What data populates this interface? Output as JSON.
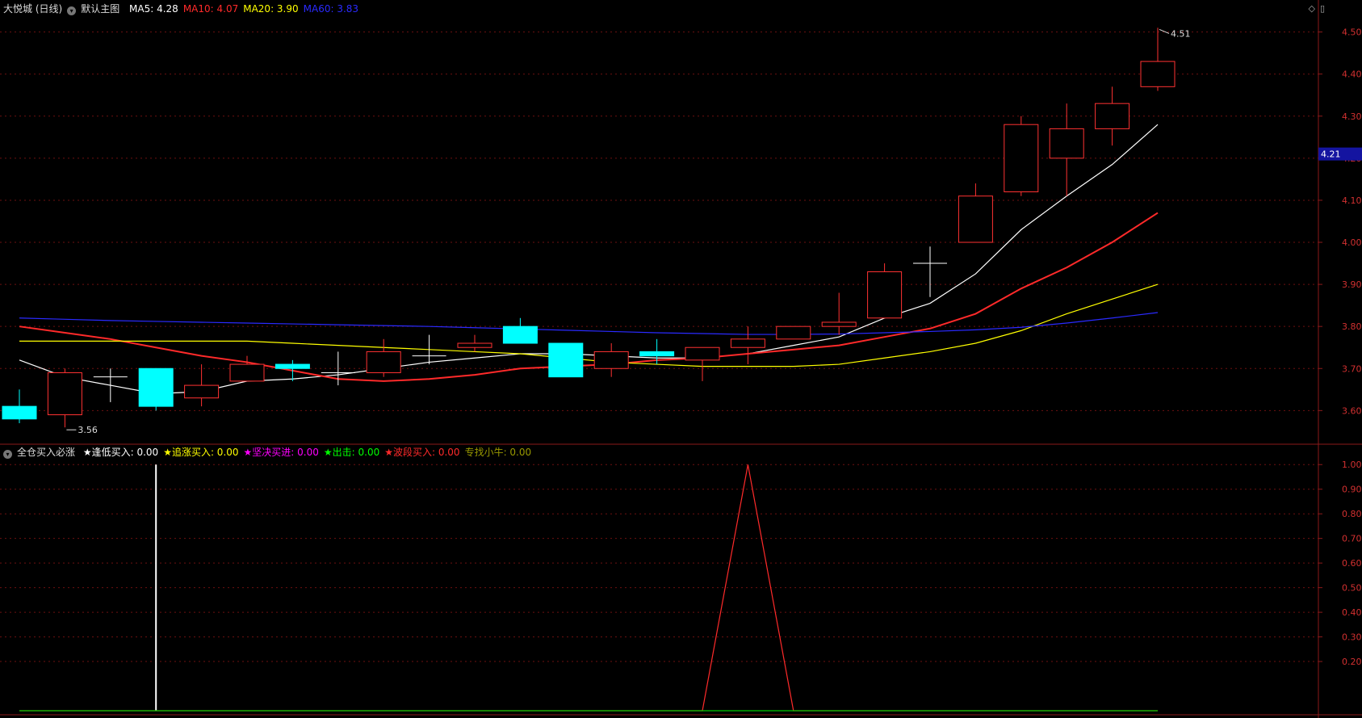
{
  "main": {
    "title": "大悦城 (日线)",
    "template": "默认主图",
    "ma": [
      {
        "label": "MA5:",
        "value": "4.28",
        "color": "#ffffff"
      },
      {
        "label": "MA10:",
        "value": "4.07",
        "color": "#ff2a2a"
      },
      {
        "label": "MA20:",
        "value": "3.90",
        "color": "#ffff00"
      },
      {
        "label": "MA60:",
        "value": "3.83",
        "color": "#2a2aff"
      }
    ],
    "last_price_tag": "4.21",
    "high_marker": "4.51",
    "low_marker": "3.56"
  },
  "sub": {
    "title": "全仓买入必涨",
    "indicators": [
      {
        "label": "★逢低买入:",
        "value": "0.00",
        "color": "#ffffff"
      },
      {
        "label": "★追涨买入:",
        "value": "0.00",
        "color": "#ffff00"
      },
      {
        "label": "★坚决买进:",
        "value": "0.00",
        "color": "#ff00ff"
      },
      {
        "label": "★出击:",
        "value": "0.00",
        "color": "#00ff00"
      },
      {
        "label": "★波段买入:",
        "value": "0.00",
        "color": "#ff2a2a"
      },
      {
        "label": "专找小牛:",
        "value": "0.00",
        "color": "#999900"
      }
    ]
  },
  "chart_data": [
    {
      "type": "candlestick",
      "name": "price",
      "ylim": [
        3.52,
        4.53
      ],
      "y_ticks": [
        "4.50",
        "4.40",
        "4.30",
        "4.20",
        "4.10",
        "4.00",
        "3.90",
        "3.80",
        "3.70",
        "3.60"
      ],
      "grid": true,
      "candles": [
        {
          "o": 3.61,
          "h": 3.65,
          "l": 3.57,
          "c": 3.58
        },
        {
          "o": 3.59,
          "h": 3.7,
          "l": 3.56,
          "c": 3.69
        },
        {
          "o": 3.68,
          "h": 3.7,
          "l": 3.62,
          "c": 3.68
        },
        {
          "o": 3.7,
          "h": 3.7,
          "l": 3.6,
          "c": 3.61
        },
        {
          "o": 3.63,
          "h": 3.71,
          "l": 3.61,
          "c": 3.66
        },
        {
          "o": 3.67,
          "h": 3.73,
          "l": 3.67,
          "c": 3.71
        },
        {
          "o": 3.71,
          "h": 3.72,
          "l": 3.67,
          "c": 3.7
        },
        {
          "o": 3.69,
          "h": 3.74,
          "l": 3.66,
          "c": 3.69
        },
        {
          "o": 3.69,
          "h": 3.77,
          "l": 3.68,
          "c": 3.74
        },
        {
          "o": 3.73,
          "h": 3.78,
          "l": 3.71,
          "c": 3.73
        },
        {
          "o": 3.75,
          "h": 3.78,
          "l": 3.74,
          "c": 3.76
        },
        {
          "o": 3.8,
          "h": 3.82,
          "l": 3.76,
          "c": 3.76
        },
        {
          "o": 3.76,
          "h": 3.76,
          "l": 3.68,
          "c": 3.68
        },
        {
          "o": 3.7,
          "h": 3.76,
          "l": 3.68,
          "c": 3.74
        },
        {
          "o": 3.74,
          "h": 3.77,
          "l": 3.71,
          "c": 3.73
        },
        {
          "o": 3.72,
          "h": 3.75,
          "l": 3.67,
          "c": 3.75
        },
        {
          "o": 3.75,
          "h": 3.8,
          "l": 3.71,
          "c": 3.77
        },
        {
          "o": 3.77,
          "h": 3.8,
          "l": 3.77,
          "c": 3.8
        },
        {
          "o": 3.8,
          "h": 3.88,
          "l": 3.78,
          "c": 3.81
        },
        {
          "o": 3.82,
          "h": 3.95,
          "l": 3.82,
          "c": 3.93
        },
        {
          "o": 3.95,
          "h": 3.99,
          "l": 3.87,
          "c": 3.95
        },
        {
          "o": 4.0,
          "h": 4.14,
          "l": 4.0,
          "c": 4.11
        },
        {
          "o": 4.12,
          "h": 4.3,
          "l": 4.11,
          "c": 4.28
        },
        {
          "o": 4.2,
          "h": 4.33,
          "l": 4.11,
          "c": 4.27
        },
        {
          "o": 4.27,
          "h": 4.37,
          "l": 4.23,
          "c": 4.33
        },
        {
          "o": 4.37,
          "h": 4.51,
          "l": 4.36,
          "c": 4.43
        }
      ],
      "ma_lines": [
        {
          "label": "MA5",
          "color": "#ffffff",
          "values": [
            3.72,
            3.68,
            3.66,
            3.64,
            3.645,
            3.67,
            3.675,
            3.685,
            3.7,
            3.715,
            3.725,
            3.735,
            3.735,
            3.73,
            3.725,
            3.725,
            3.735,
            3.755,
            3.775,
            3.82,
            3.855,
            3.925,
            4.03,
            4.11,
            4.185,
            4.28
          ]
        },
        {
          "label": "MA10",
          "color": "#ff2a2a",
          "values": [
            3.8,
            3.785,
            3.77,
            3.75,
            3.73,
            3.715,
            3.695,
            3.675,
            3.67,
            3.675,
            3.685,
            3.7,
            3.705,
            3.71,
            3.72,
            3.725,
            3.735,
            3.745,
            3.755,
            3.775,
            3.795,
            3.83,
            3.89,
            3.94,
            4.0,
            4.07
          ]
        },
        {
          "label": "MA20",
          "color": "#ffff00",
          "values": [
            3.765,
            3.765,
            3.765,
            3.765,
            3.765,
            3.765,
            3.76,
            3.755,
            3.75,
            3.745,
            3.74,
            3.735,
            3.725,
            3.715,
            3.71,
            3.705,
            3.705,
            3.705,
            3.71,
            3.725,
            3.74,
            3.76,
            3.79,
            3.83,
            3.865,
            3.9
          ]
        },
        {
          "label": "MA60",
          "color": "#2a2aff",
          "values": [
            3.82,
            3.817,
            3.814,
            3.812,
            3.81,
            3.808,
            3.806,
            3.804,
            3.802,
            3.8,
            3.797,
            3.794,
            3.791,
            3.788,
            3.785,
            3.783,
            3.781,
            3.781,
            3.782,
            3.785,
            3.788,
            3.792,
            3.798,
            3.808,
            3.82,
            3.833
          ]
        }
      ]
    },
    {
      "type": "line",
      "name": "indicator",
      "ylim": [
        0,
        1.05
      ],
      "y_ticks": [
        "1.00",
        "0.90",
        "0.80",
        "0.70",
        "0.60",
        "0.50",
        "0.40",
        "0.30",
        "0.20"
      ],
      "grid": true,
      "series": [
        {
          "label": "逢低买入",
          "color": "#ffffff",
          "style": "stick",
          "values": [
            0,
            0,
            0,
            1,
            0,
            0,
            0,
            0,
            0,
            0,
            0,
            0,
            0,
            0,
            0,
            0,
            0,
            0,
            0,
            0,
            0,
            0,
            0,
            0,
            0,
            0
          ]
        },
        {
          "label": "波段买入",
          "color": "#ff2a2a",
          "style": "line",
          "values": [
            0,
            0,
            0,
            0,
            0,
            0,
            0,
            0,
            0,
            0,
            0,
            0,
            0,
            0,
            0,
            0,
            1,
            0,
            0,
            0,
            0,
            0,
            0,
            0,
            0,
            0
          ]
        },
        {
          "label": "出击",
          "color": "#00cc00",
          "style": "line",
          "values": [
            0,
            0,
            0,
            0,
            0,
            0,
            0,
            0,
            0,
            0,
            0,
            0,
            0,
            0,
            0,
            0,
            0,
            0,
            0,
            0,
            0,
            0,
            0,
            0,
            0,
            0
          ]
        }
      ]
    }
  ]
}
